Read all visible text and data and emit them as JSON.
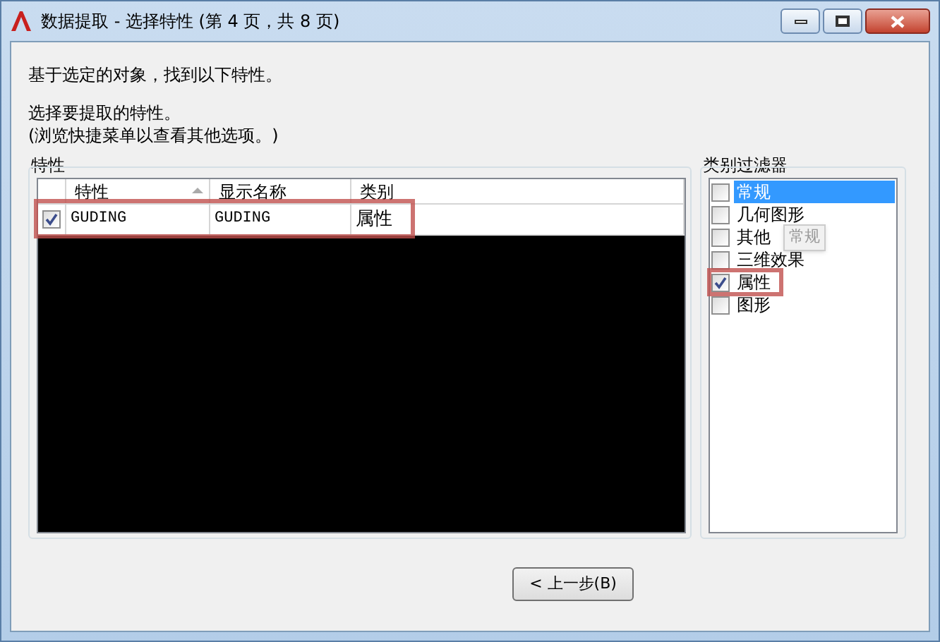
{
  "window": {
    "title": "数据提取 - 选择特性 (第 4 页，共 8 页)"
  },
  "intro": "基于选定的对象，找到以下特性。",
  "instruction": "选择要提取的特性。",
  "hint": "(浏览快捷菜单以查看其他选项。)",
  "properties_group": {
    "label": "特性",
    "columns": [
      {
        "label": "特性",
        "sorted": true
      },
      {
        "label": "显示名称",
        "sorted": false
      },
      {
        "label": "类别",
        "sorted": false
      }
    ],
    "rows": [
      {
        "checked": true,
        "highlighted": true,
        "cells": [
          "GUDING",
          "GUDING",
          "属性"
        ]
      }
    ]
  },
  "filter_group": {
    "label": "类别过滤器",
    "items": [
      {
        "label": "常规",
        "checked": false,
        "selected": true,
        "highlighted": false
      },
      {
        "label": "几何图形",
        "checked": false,
        "selected": false,
        "highlighted": false
      },
      {
        "label": "其他",
        "checked": false,
        "selected": false,
        "highlighted": false
      },
      {
        "label": "三维效果",
        "checked": false,
        "selected": false,
        "highlighted": false
      },
      {
        "label": "属性",
        "checked": true,
        "selected": false,
        "highlighted": true
      },
      {
        "label": "图形",
        "checked": false,
        "selected": false,
        "highlighted": false
      }
    ],
    "tooltip": "常规"
  },
  "buttons": [
    {
      "label": "< 上一步(B)"
    }
  ]
}
